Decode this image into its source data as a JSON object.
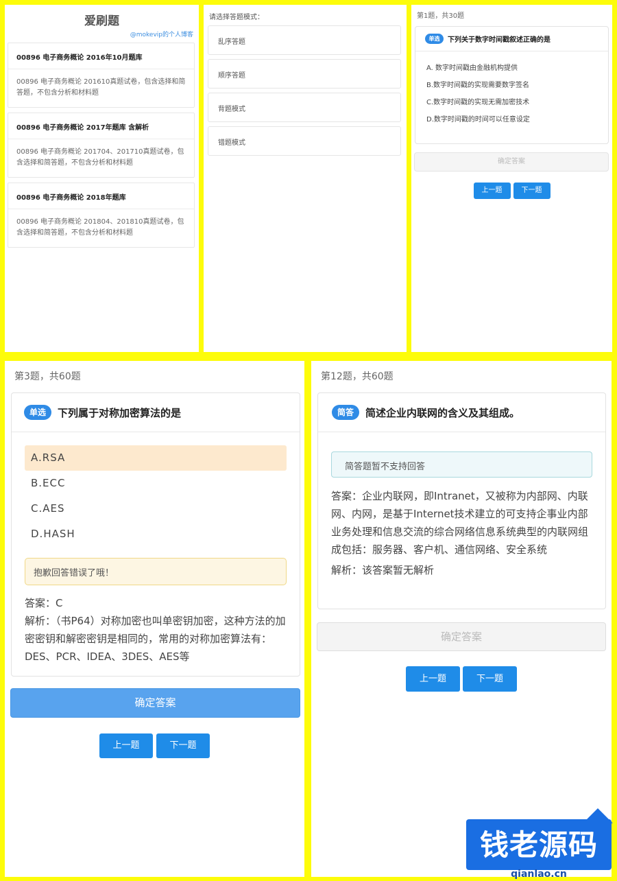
{
  "home": {
    "title": "爱刷题",
    "author": "@mokevip的个人博客",
    "banks": [
      {
        "title": "00896 电子商务概论 2016年10月题库",
        "desc": "00896 电子商务概论 201610真题试卷，包含选择和简答题，不包含分析和材料题"
      },
      {
        "title": "00896 电子商务概论 2017年题库 含解析",
        "desc": "00896 电子商务概论 201704、201710真题试卷，包含选择和简答题，不包含分析和材料题"
      },
      {
        "title": "00896 电子商务概论 2018年题库",
        "desc": "00896 电子商务概论 201804、201810真题试卷，包含选择和简答题，不包含分析和材料题"
      }
    ]
  },
  "mode_select": {
    "prompt": "请选择答题模式：",
    "modes": [
      "乱序答题",
      "顺序答题",
      "背题模式",
      "错题模式"
    ]
  },
  "question1": {
    "counter": "第1题，共30题",
    "badge": "单选",
    "text": "下列关于数字时间戳叙述正确的是",
    "options": [
      "A. 数字时间戳由金融机构提供",
      "B.数字时间戳的实现需要数字签名",
      "C.数字时间戳的实现无需加密技术",
      "D.数字时间戳的时间可以任意设定"
    ],
    "confirm": "确定答案",
    "prev": "上一题",
    "next": "下一题"
  },
  "question3": {
    "counter": "第3题，共60题",
    "badge": "单选",
    "text": "下列属于对称加密算法的是",
    "options": [
      "A.RSA",
      "B.ECC",
      "C.AES",
      "D.HASH"
    ],
    "selected_index": 0,
    "error_message": "抱歉回答错误了哦！",
    "answer": "答案：C",
    "analysis": "解析：（书P64）对称加密也叫单密钥加密，这种方法的加密密钥和解密密钥是相同的，常用的对称加密算法有：DES、PCR、IDEA、3DES、AES等",
    "confirm": "确定答案",
    "prev": "上一题",
    "next": "下一题"
  },
  "question12": {
    "counter": "第12题，共60题",
    "badge": "简答",
    "text": "简述企业内联网的含义及其组成。",
    "notice": "简答题暂不支持回答",
    "answer": "答案：企业内联网，即Intranet，又被称为内部网、内联网、内网，是基于Internet技术建立的可支持企事业内部业务处理和信息交流的综合网络信息系统典型的内联网组成包括：服务器、客户机、通信网络、安全系统",
    "analysis": "解析：该答案暂无解析",
    "confirm": "确定答案",
    "prev": "上一题",
    "next": "下一题"
  },
  "watermark": {
    "text": "钱老源码",
    "domain": "qianlao.cn"
  },
  "colors": {
    "background": "#fdfc0a",
    "primary": "#1f8ce8",
    "selected_option": "#fde9ce",
    "error_bg": "#fdf6e3",
    "notice_bg": "#eef8fa"
  }
}
